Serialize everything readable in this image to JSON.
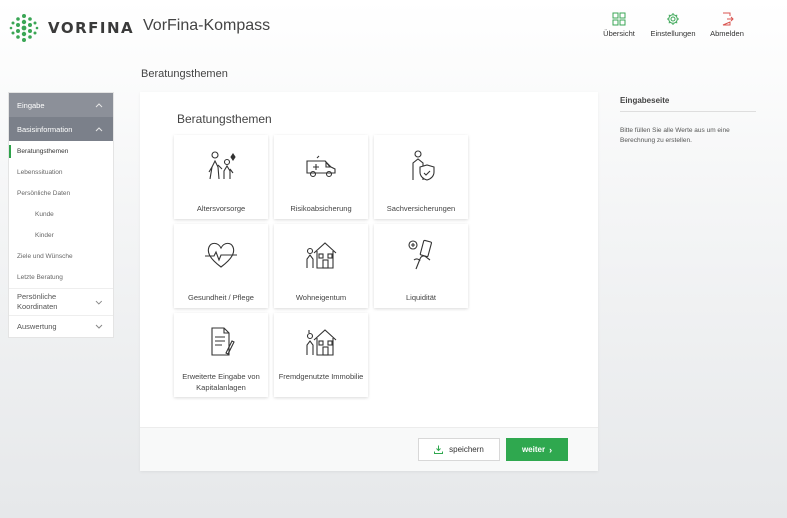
{
  "header": {
    "brand": "VORFINA",
    "app_title": "VorFina-Kompass",
    "actions": [
      {
        "label": "Übersicht",
        "icon": "grid-icon"
      },
      {
        "label": "Einstellungen",
        "icon": "gear-icon"
      },
      {
        "label": "Abmelden",
        "icon": "logout-icon"
      }
    ]
  },
  "page_heading": "Beratungsthemen",
  "sidebar": {
    "groups": [
      {
        "label": "Eingabe"
      },
      {
        "label": "Basisinformation"
      }
    ],
    "items": [
      {
        "label": "Beratungsthemen"
      },
      {
        "label": "Lebenssituation"
      },
      {
        "label": "Persönliche Daten"
      },
      {
        "label": "Kunde"
      },
      {
        "label": "Kinder"
      },
      {
        "label": "Ziele und Wünsche"
      },
      {
        "label": "Letzte Beratung"
      }
    ],
    "collapsed": [
      {
        "label": "Persönliche Koordinaten"
      },
      {
        "label": "Auswertung"
      }
    ]
  },
  "main": {
    "title": "Beratungsthemen",
    "tiles": [
      {
        "label": "Altersvorsorge",
        "icon": "elderly-couple-icon"
      },
      {
        "label": "Risikoabsicherung",
        "icon": "ambulance-icon"
      },
      {
        "label": "Sachversicherungen",
        "icon": "person-shield-icon"
      },
      {
        "label": "Gesundheit / Pflege",
        "icon": "heart-pulse-icon"
      },
      {
        "label": "Wohneigentum",
        "icon": "house-person-icon"
      },
      {
        "label": "Liquidität",
        "icon": "hand-phone-icon"
      },
      {
        "label": "Erweiterte Eingabe von Kapitalanlagen",
        "icon": "document-pen-icon"
      },
      {
        "label": "Fremdgenutzte Immobilie",
        "icon": "rental-house-icon"
      }
    ],
    "save_label": "speichern",
    "next_label": "weiter",
    "accent_color": "#2fa84f"
  },
  "info_panel": {
    "title": "Eingabeseite",
    "text": "Bitte füllen Sie alle Werte aus um eine Berechnung zu erstellen."
  }
}
